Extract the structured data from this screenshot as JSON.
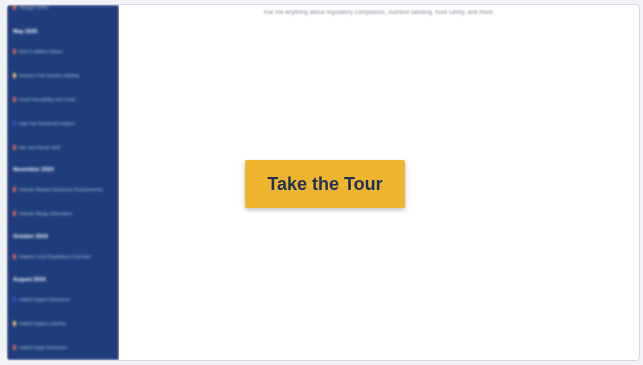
{
  "colors": {
    "sidebar_bg": "#1e3d7a",
    "accent_button": "#f0b52f",
    "button_text": "#1e3155"
  },
  "main": {
    "hint_text": "Ask me anything about regulatory compliance, nutrition labeling, food safety, and more.",
    "tour_button_label": "Take the Tour"
  },
  "sidebar": {
    "groups": [
      {
        "heading": "May 2025",
        "items": [
          {
            "label": "Red 3 Additive Status",
            "icon": "lock-icon"
          },
          {
            "label": "Dummy Fruit Snacks Labeling",
            "icon": "note-icon"
          },
          {
            "label": "Food Traceability List Foods",
            "icon": "lock-icon"
          },
          {
            "label": "High Fat Threshold Analysis",
            "icon": "chart-icon"
          },
          {
            "label": "Nec and Reuse Well",
            "icon": "lock-icon"
          }
        ]
      },
      {
        "heading": "November 2024",
        "items": [
          {
            "label": "Natural Allergen Disclosure Requirements",
            "icon": "lock-icon"
          },
          {
            "label": "Natural Allergy Information",
            "icon": "lock-icon"
          }
        ]
      },
      {
        "heading": "October 2024",
        "items": [
          {
            "label": "Organic Food Regulations Overview",
            "icon": "lock-icon"
          }
        ]
      },
      {
        "heading": "August 2024",
        "items": [
          {
            "label": "Added Sugars Disclosure",
            "icon": "chart-icon"
          },
          {
            "label": "Added Sugars Labeling",
            "icon": "note-icon"
          },
          {
            "label": "Added Sugar Disclosure",
            "icon": "lock-icon"
          }
        ]
      }
    ]
  }
}
